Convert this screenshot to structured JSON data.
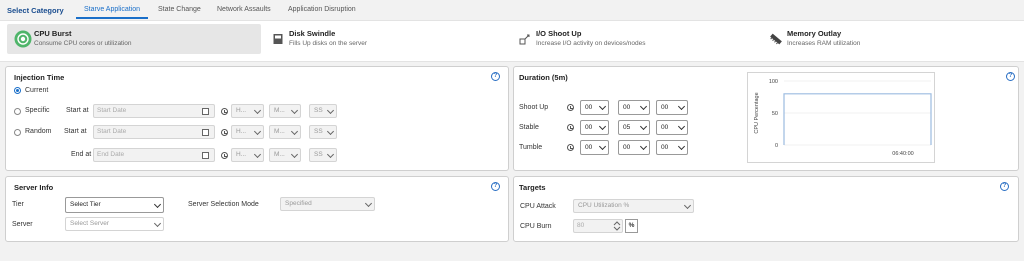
{
  "category": {
    "title": "Select Category",
    "tabs": [
      {
        "label": "Starve Application",
        "active": true
      },
      {
        "label": "State Change",
        "active": false
      },
      {
        "label": "Network Assaults",
        "active": false
      },
      {
        "label": "Application Disruption",
        "active": false
      }
    ]
  },
  "attacks": [
    {
      "title": "CPU Burst",
      "desc": "Consume CPU cores or utilization",
      "selected": true,
      "icon": "cpu-icon"
    },
    {
      "title": "Disk Swindle",
      "desc": "Fills Up disks on the server",
      "selected": false,
      "icon": "disk-icon"
    },
    {
      "title": "I/O Shoot Up",
      "desc": "Increase I/O activity on devices/nodes",
      "selected": false,
      "icon": "io-icon"
    },
    {
      "title": "Memory Outlay",
      "desc": "Increases RAM utilization",
      "selected": false,
      "icon": "memory-icon"
    }
  ],
  "injection": {
    "title": "Injection Time",
    "current_label": "Current",
    "specific_label": "Specific",
    "random_label": "Random",
    "start_at_label": "Start at",
    "end_at_label": "End at",
    "start_date_placeholder": "Start Date",
    "end_date_placeholder": "End Date",
    "hour_placeholder": "H...",
    "minute_placeholder": "M...",
    "second_placeholder": "SS"
  },
  "duration": {
    "title": "Duration (5m)",
    "rows": [
      {
        "label": "Shoot Up",
        "h": "00",
        "m": "00",
        "s": "00"
      },
      {
        "label": "Stable",
        "h": "00",
        "m": "05",
        "s": "00"
      },
      {
        "label": "Tumble",
        "h": "00",
        "m": "00",
        "s": "00"
      }
    ]
  },
  "chart_data": {
    "type": "line",
    "ylabel": "CPU Percentage",
    "ylim": [
      0,
      100
    ],
    "yticks": [
      0,
      50,
      100
    ],
    "xticks": [
      "06:40:00"
    ],
    "series": [
      {
        "x": [
          0,
          0,
          5,
          5
        ],
        "y": [
          0,
          80,
          80,
          0
        ]
      }
    ],
    "xlim": [
      0,
      5
    ],
    "line_color": "#9bbbe0"
  },
  "server": {
    "title": "Server Info",
    "tier_label": "Tier",
    "tier_value": "Select Tier",
    "server_label": "Server",
    "server_placeholder": "Select Server",
    "mode_label": "Server Selection Mode",
    "mode_value": "Specified"
  },
  "targets": {
    "title": "Targets",
    "cpu_attack_label": "CPU Attack",
    "cpu_attack_value": "CPU Utilization %",
    "cpu_burn_label": "CPU Burn",
    "cpu_burn_value": "80",
    "unit": "%"
  },
  "help_glyph": "?"
}
